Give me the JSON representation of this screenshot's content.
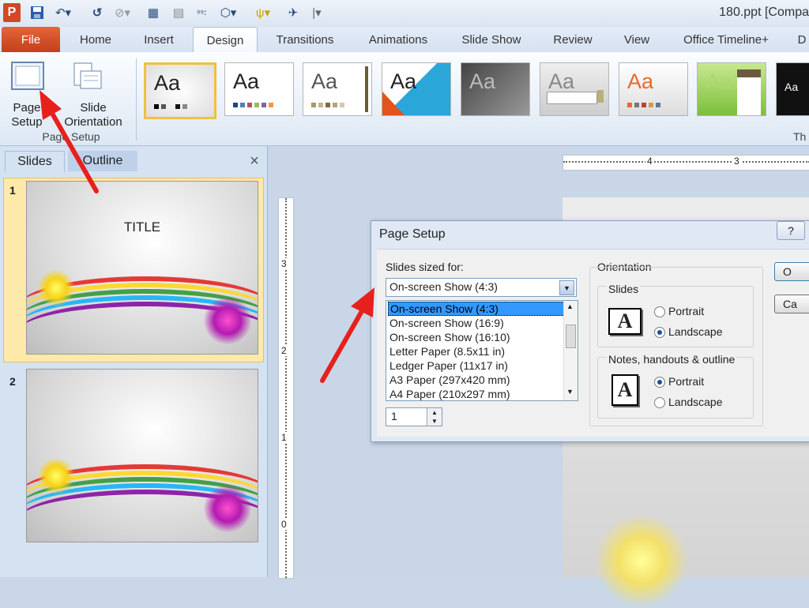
{
  "app": {
    "logo": "P",
    "title": "180.ppt [Compa"
  },
  "quick_access": [
    "save-icon",
    "undo-icon",
    "redo-icon",
    "circle-icon",
    "grid-icon",
    "abc-icon",
    "more-icon"
  ],
  "tabs": [
    "File",
    "Home",
    "Insert",
    "Design",
    "Transitions",
    "Animations",
    "Slide Show",
    "Review",
    "View",
    "Office Timeline+",
    "D"
  ],
  "active_tab": "Design",
  "ribbon": {
    "page_setup_label": "Page Setup",
    "page_setup_button": "Page\nSetup",
    "slide_orientation_button": "Slide\nOrientation",
    "group_label": "Page Setup",
    "themes_label": "Th",
    "theme_sample": "Aa"
  },
  "left_pane": {
    "tabs": [
      "Slides",
      "Outline"
    ],
    "close": "×",
    "slides": [
      {
        "number": "1",
        "title": "TITLE"
      },
      {
        "number": "2",
        "title": ""
      }
    ]
  },
  "ruler": {
    "h_marks": [
      "4",
      "3"
    ],
    "v_marks": [
      "3",
      "2",
      "1",
      "0"
    ]
  },
  "dialog": {
    "title": "Page Setup",
    "help": "?",
    "slides_sized_for_label": "Slides sized for:",
    "selected_size": "On-screen Show (4:3)",
    "size_options": [
      "On-screen Show (4:3)",
      "On-screen Show (16:9)",
      "On-screen Show (16:10)",
      "Letter Paper (8.5x11 in)",
      "Ledger Paper (11x17 in)",
      "A3 Paper (297x420 mm)",
      "A4 Paper (210x297 mm)"
    ],
    "number_value": "1",
    "orientation_label": "Orientation",
    "slides_group": "Slides",
    "notes_group": "Notes, handouts & outline",
    "portrait": "Portrait",
    "landscape": "Landscape",
    "ok_button": "O",
    "cancel_button": "Ca",
    "slides_orientation_selected": "Landscape",
    "notes_orientation_selected": "Portrait"
  },
  "colors": {
    "accent": "#d24726",
    "arrow": "#e8201b",
    "selection": "#3399ff"
  }
}
